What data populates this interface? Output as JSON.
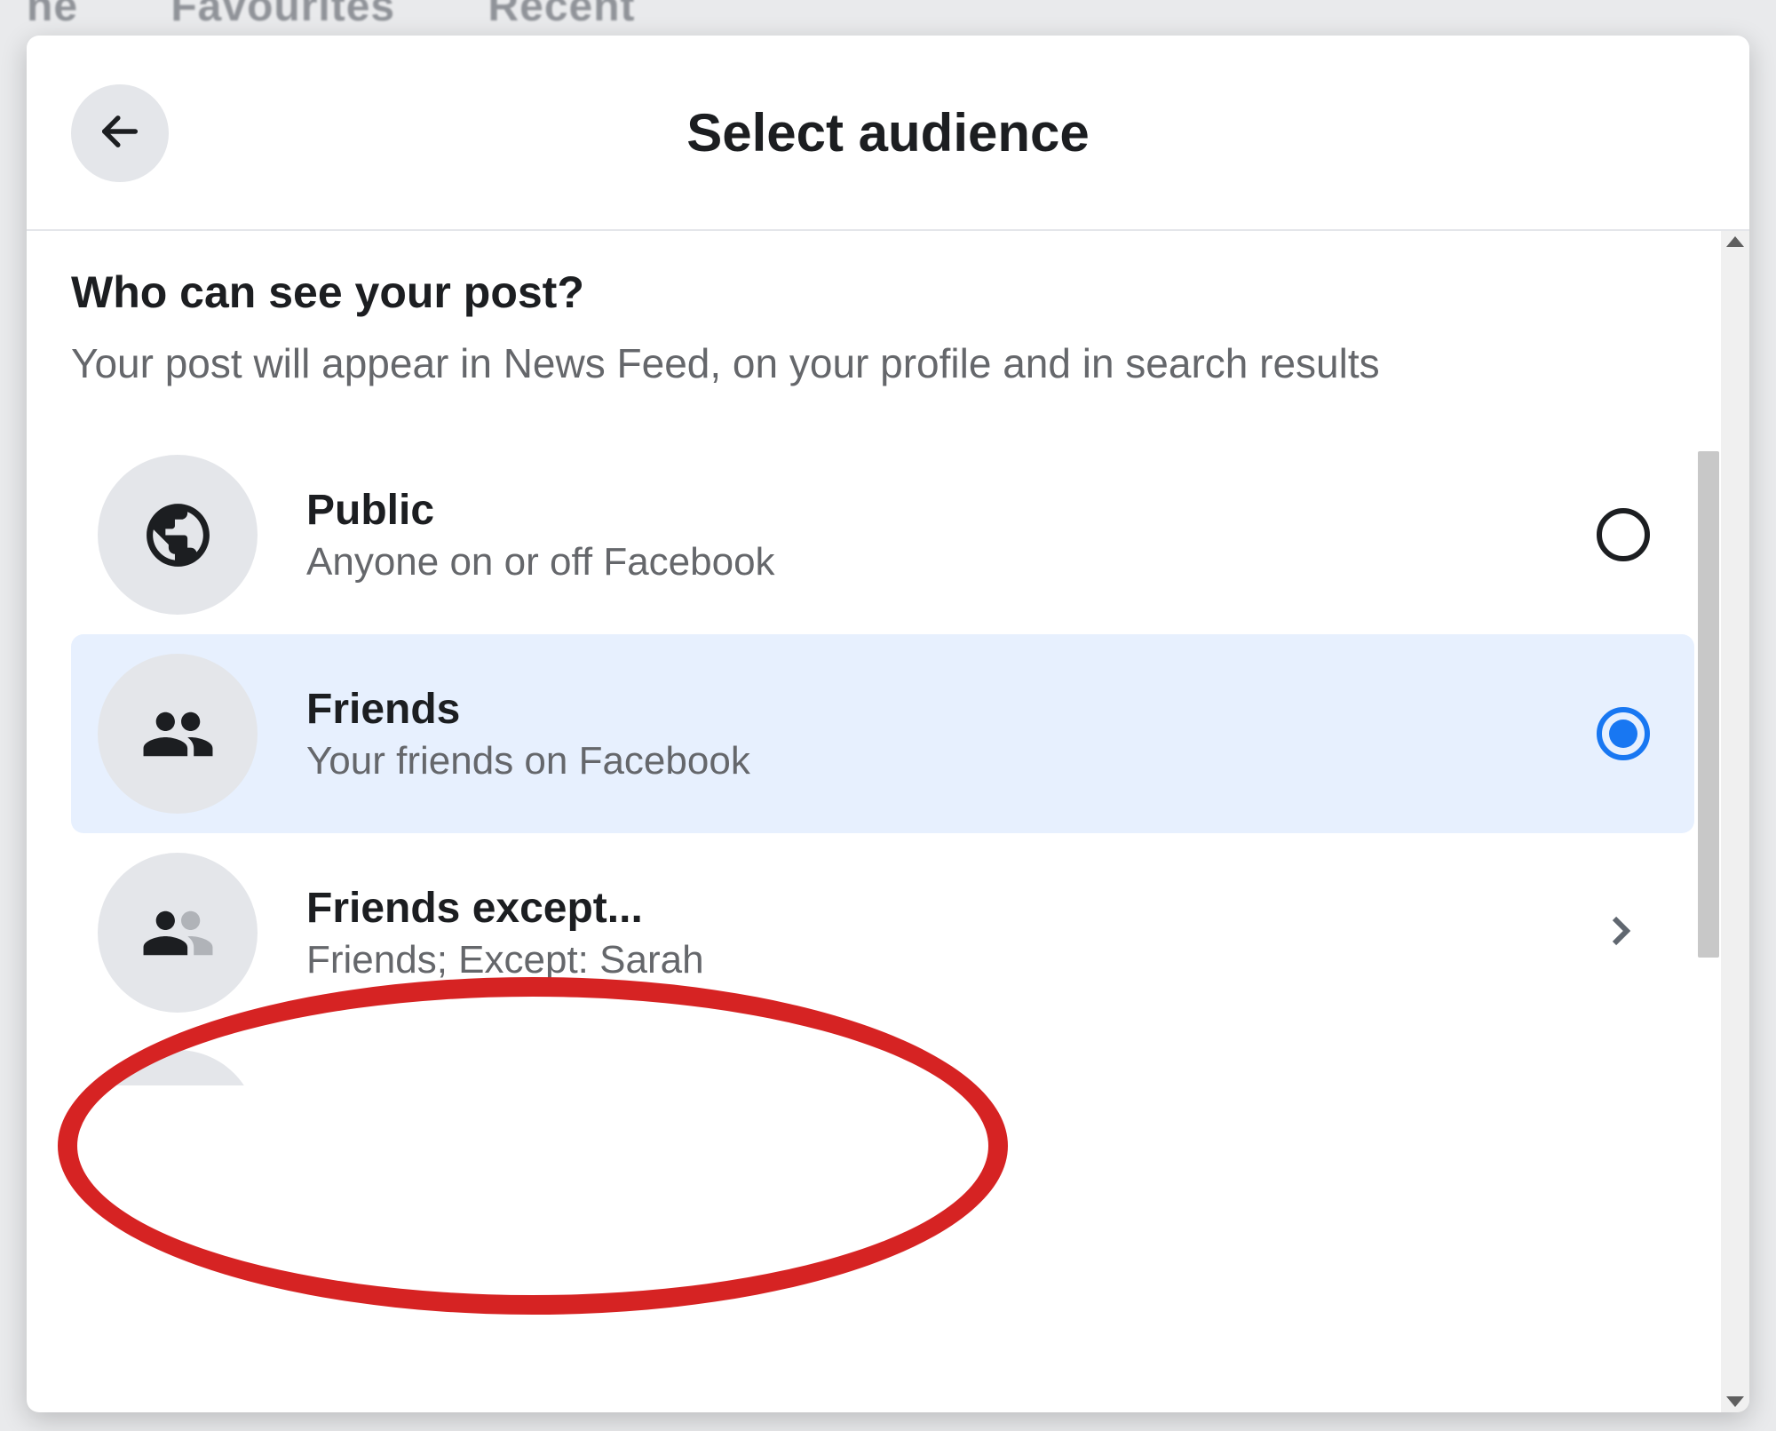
{
  "background_tabs": [
    "ne",
    "Favourites",
    "Recent"
  ],
  "header": {
    "title": "Select audience"
  },
  "body": {
    "heading": "Who can see your post?",
    "description": "Your post will appear in News Feed, on your profile and in search results"
  },
  "options": [
    {
      "icon": "globe",
      "title": "Public",
      "subtitle": "Anyone on or off Facebook",
      "control": "radio",
      "selected": false
    },
    {
      "icon": "friends",
      "title": "Friends",
      "subtitle": "Your friends on Facebook",
      "control": "radio",
      "selected": true
    },
    {
      "icon": "friends-except",
      "title": "Friends except...",
      "subtitle": "Friends; Except: Sarah",
      "control": "chevron",
      "selected": false
    }
  ],
  "annotation": {
    "type": "ellipse",
    "color": "#d62323",
    "target_option_index": 2
  }
}
